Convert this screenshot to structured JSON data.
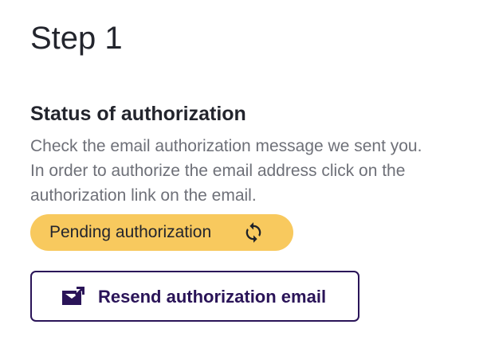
{
  "step": {
    "title": "Step 1"
  },
  "authorization": {
    "heading": "Status of authorization",
    "description_lines": [
      "Check the email authorization message we sent you.",
      "In order to authorize the email address click on the",
      "authorization link on the email."
    ],
    "status": {
      "label": "Pending authorization",
      "icon": "sync-icon",
      "background_color": "#f8c95e"
    },
    "resend_button": {
      "label": "Resend authorization email",
      "icon": "mail-send-icon",
      "border_color": "#2a1458",
      "text_color": "#2a1458"
    }
  }
}
